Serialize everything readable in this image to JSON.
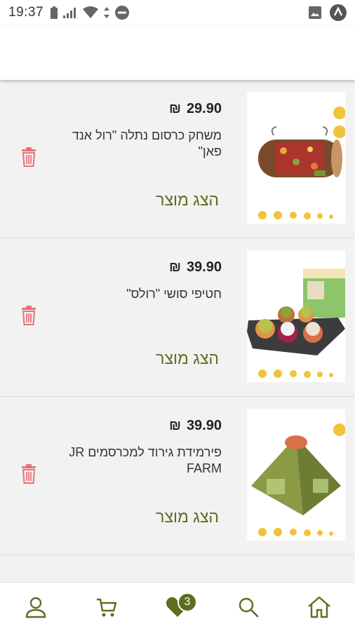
{
  "status_bar": {
    "time": "19:37"
  },
  "colors": {
    "brand": "#5c6e1f",
    "delete": "#e4737b"
  },
  "products": [
    {
      "price": "29.90",
      "currency": "₪",
      "title": "משחק כרסום נתלה \"רול אנד פאן\"",
      "cta": "הצג מוצר",
      "image_icon": "hanging-log-toy"
    },
    {
      "price": "39.90",
      "currency": "₪",
      "title": "חטיפי סושי \"רולס\"",
      "cta": "הצג מוצר",
      "image_icon": "sushi-rolls-tray"
    },
    {
      "price": "39.90",
      "currency": "₪",
      "title": "פירמידת גירוד למכרסמים JR FARM",
      "cta": "הצג מוצר",
      "image_icon": "hay-pyramid"
    }
  ],
  "bottom_nav": {
    "items": [
      "profile-icon",
      "cart-icon",
      "heart-icon",
      "search-icon",
      "home-icon"
    ],
    "favorites_count": "3"
  }
}
